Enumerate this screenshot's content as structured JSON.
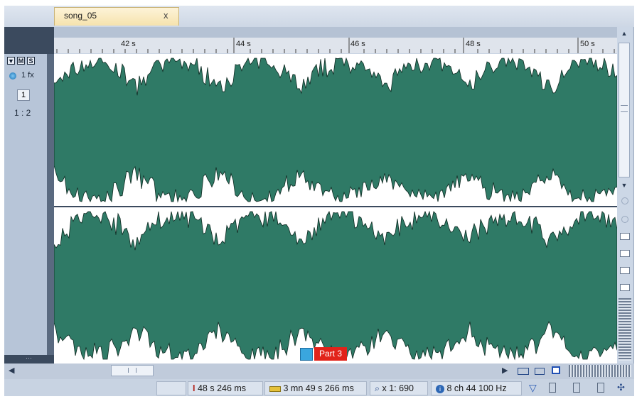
{
  "tab": {
    "title": "song_05",
    "close": "x"
  },
  "track": {
    "fx_label": "1 fx",
    "number": "1",
    "ratio": "1 : 2",
    "buttons": [
      "▼",
      "M",
      "S"
    ]
  },
  "ruler": {
    "labels": [
      "42 s",
      "44 s",
      "46 s",
      "48 s",
      "50 s"
    ]
  },
  "marker": {
    "label": "Part 3"
  },
  "status": {
    "cursor_position": "48 s 246 ms",
    "length": "3 mn 49 s 266 ms",
    "zoom": "x 1: 690",
    "format": "8 ch 44 100 Hz"
  },
  "colors": {
    "waveform_fill": "#2f7a66",
    "waveform_outline": "#0f2a22",
    "marker_bg": "#e2231a"
  },
  "icons": {
    "cursor": "i-beam-icon",
    "length": "ruler-icon",
    "zoom": "magnifier-icon",
    "info": "info-icon",
    "filter": "funnel-icon"
  }
}
